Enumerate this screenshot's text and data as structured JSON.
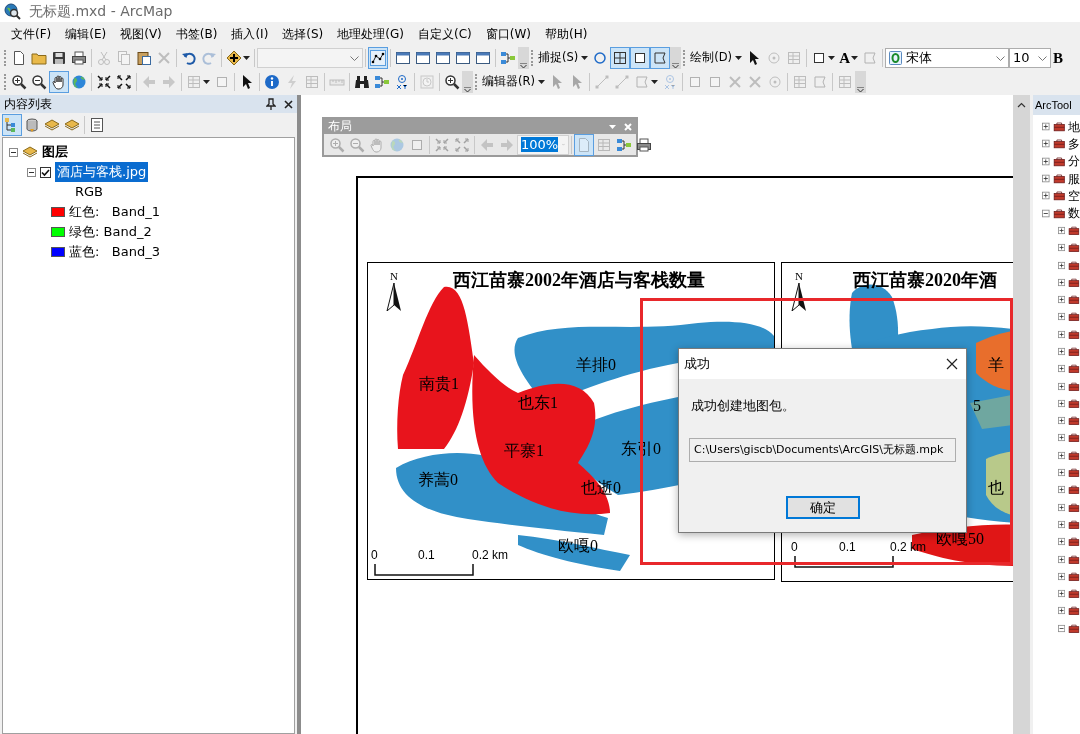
{
  "window": {
    "title": "无标题.mxd - ArcMap"
  },
  "menu": [
    "文件(F)",
    "编辑(E)",
    "视图(V)",
    "书签(B)",
    "插入(I)",
    "选择(S)",
    "地理处理(G)",
    "自定义(C)",
    "窗口(W)",
    "帮助(H)"
  ],
  "toolbar_1": [
    {
      "kind": "grip"
    },
    {
      "kind": "icon",
      "disabled": false,
      "pressed": false
    },
    {
      "kind": "icon",
      "disabled": false,
      "pressed": false
    },
    {
      "kind": "icon",
      "disabled": false,
      "pressed": false
    },
    {
      "kind": "icon",
      "disabled": false,
      "pressed": false
    },
    {
      "kind": "sep"
    },
    {
      "kind": "icon",
      "disabled": true,
      "pressed": false
    },
    {
      "kind": "icon",
      "disabled": true,
      "pressed": false
    },
    {
      "kind": "icon",
      "disabled": false,
      "pressed": false
    },
    {
      "kind": "icon",
      "disabled": true,
      "pressed": false
    },
    {
      "kind": "sep"
    },
    {
      "kind": "icon",
      "disabled": false,
      "pressed": false
    },
    {
      "kind": "icon",
      "disabled": true,
      "pressed": false
    },
    {
      "kind": "sep"
    },
    {
      "kind": "icon",
      "disabled": false,
      "pressed": false,
      "dropdown": true
    },
    {
      "kind": "sep"
    },
    {
      "kind": "combo",
      "disabled": true
    },
    {
      "kind": "sep"
    },
    {
      "kind": "icon",
      "disabled": false,
      "pressed": true
    },
    {
      "kind": "sep"
    },
    {
      "kind": "icon",
      "disabled": false,
      "pressed": false
    },
    {
      "kind": "icon",
      "disabled": false,
      "pressed": false
    },
    {
      "kind": "icon",
      "disabled": false,
      "pressed": false
    },
    {
      "kind": "icon",
      "disabled": false,
      "pressed": false
    },
    {
      "kind": "icon",
      "disabled": false,
      "pressed": false
    },
    {
      "kind": "sep"
    },
    {
      "kind": "icon",
      "disabled": false,
      "pressed": false
    },
    {
      "kind": "overflow"
    },
    {
      "kind": "grip"
    },
    {
      "kind": "menu",
      "label": "捕捉(S)"
    },
    {
      "kind": "icon",
      "disabled": false,
      "pressed": false
    },
    {
      "kind": "icon",
      "disabled": false,
      "pressed": true
    },
    {
      "kind": "icon",
      "disabled": false,
      "pressed": true
    },
    {
      "kind": "icon",
      "disabled": false,
      "pressed": true
    },
    {
      "kind": "overflow"
    },
    {
      "kind": "grip"
    },
    {
      "kind": "menu",
      "label": "绘制(D)"
    },
    {
      "kind": "icon",
      "disabled": false,
      "pressed": false
    },
    {
      "kind": "icon",
      "disabled": true,
      "pressed": false
    },
    {
      "kind": "icon",
      "disabled": true,
      "pressed": false
    },
    {
      "kind": "sep"
    },
    {
      "kind": "icon",
      "disabled": false,
      "pressed": false,
      "dropdown": true
    },
    {
      "kind": "letter",
      "label": "A",
      "dropdown": true
    },
    {
      "kind": "icon",
      "disabled": true,
      "pressed": false
    },
    {
      "kind": "sep"
    },
    {
      "kind": "font_combo",
      "value": "宋体"
    },
    {
      "kind": "combo",
      "value": "10",
      "disabled": false
    },
    {
      "kind": "letter",
      "label": "B"
    }
  ],
  "toolbar_2": [
    {
      "kind": "grip"
    },
    {
      "kind": "icon",
      "disabled": false,
      "pressed": false
    },
    {
      "kind": "icon",
      "disabled": false,
      "pressed": false
    },
    {
      "kind": "icon",
      "disabled": false,
      "pressed": true
    },
    {
      "kind": "icon",
      "disabled": false,
      "pressed": false
    },
    {
      "kind": "sep"
    },
    {
      "kind": "icon",
      "disabled": false,
      "pressed": false
    },
    {
      "kind": "icon",
      "disabled": false,
      "pressed": false
    },
    {
      "kind": "sep"
    },
    {
      "kind": "icon",
      "disabled": true,
      "pressed": false
    },
    {
      "kind": "icon",
      "disabled": true,
      "pressed": false
    },
    {
      "kind": "sep"
    },
    {
      "kind": "icon",
      "disabled": true,
      "pressed": false,
      "dropdown": true
    },
    {
      "kind": "icon",
      "disabled": true,
      "pressed": false
    },
    {
      "kind": "sep"
    },
    {
      "kind": "icon",
      "disabled": false,
      "pressed": false
    },
    {
      "kind": "sep"
    },
    {
      "kind": "icon",
      "disabled": false,
      "pressed": false
    },
    {
      "kind": "icon",
      "disabled": true,
      "pressed": false
    },
    {
      "kind": "icon",
      "disabled": true,
      "pressed": false
    },
    {
      "kind": "sep"
    },
    {
      "kind": "icon",
      "disabled": true,
      "pressed": false
    },
    {
      "kind": "sep"
    },
    {
      "kind": "icon",
      "disabled": false,
      "pressed": false
    },
    {
      "kind": "icon",
      "disabled": false,
      "pressed": false
    },
    {
      "kind": "icon",
      "disabled": false,
      "pressed": false
    },
    {
      "kind": "sep"
    },
    {
      "kind": "icon",
      "disabled": true,
      "pressed": false
    },
    {
      "kind": "sep"
    },
    {
      "kind": "icon",
      "disabled": false,
      "pressed": false
    },
    {
      "kind": "overflow"
    },
    {
      "kind": "grip"
    },
    {
      "kind": "menu",
      "label": "编辑器(R)"
    },
    {
      "kind": "icon",
      "disabled": true,
      "pressed": false
    },
    {
      "kind": "icon",
      "disabled": true,
      "pressed": false
    },
    {
      "kind": "sep"
    },
    {
      "kind": "icon",
      "disabled": true,
      "pressed": false
    },
    {
      "kind": "icon",
      "disabled": true,
      "pressed": false
    },
    {
      "kind": "icon",
      "disabled": true,
      "pressed": false,
      "dropdown": true
    },
    {
      "kind": "icon",
      "disabled": true,
      "pressed": false
    },
    {
      "kind": "sep"
    },
    {
      "kind": "icon",
      "disabled": true,
      "pressed": false
    },
    {
      "kind": "icon",
      "disabled": true,
      "pressed": false
    },
    {
      "kind": "icon",
      "disabled": true,
      "pressed": false
    },
    {
      "kind": "icon",
      "disabled": true,
      "pressed": false
    },
    {
      "kind": "icon",
      "disabled": true,
      "pressed": false
    },
    {
      "kind": "sep"
    },
    {
      "kind": "icon",
      "disabled": true,
      "pressed": false
    },
    {
      "kind": "icon",
      "disabled": true,
      "pressed": false
    },
    {
      "kind": "sep"
    },
    {
      "kind": "icon",
      "disabled": true,
      "pressed": false
    },
    {
      "kind": "overflow"
    }
  ],
  "toc": {
    "title": "内容列表",
    "toolbar": [
      {
        "kind": "icon",
        "pressed": true
      },
      {
        "kind": "icon",
        "pressed": false
      },
      {
        "kind": "icon",
        "pressed": false
      },
      {
        "kind": "icon",
        "pressed": false
      },
      {
        "kind": "sep"
      },
      {
        "kind": "icon",
        "pressed": false
      }
    ],
    "tree": [
      {
        "label": "图层",
        "expanded": true,
        "children": [
          {
            "label": "酒店与客栈.jpg",
            "expanded": true,
            "checked": true,
            "selected": true,
            "sublabel": "RGB",
            "legend": [
              {
                "text": "红色:   Band_1",
                "color": "#ff0000"
              },
              {
                "text": "绿色: Band_2",
                "color": "#00ff00"
              },
              {
                "text": "蓝色:   Band_3",
                "color": "#0000ff"
              }
            ]
          }
        ]
      }
    ]
  },
  "layout_toolbar": {
    "title": "布局",
    "items": [
      {
        "kind": "icon",
        "disabled": true,
        "pressed": false
      },
      {
        "kind": "icon",
        "disabled": true,
        "pressed": false
      },
      {
        "kind": "icon",
        "disabled": true,
        "pressed": false
      },
      {
        "kind": "icon",
        "disabled": true,
        "pressed": false
      },
      {
        "kind": "icon",
        "disabled": true,
        "pressed": false
      },
      {
        "kind": "sep"
      },
      {
        "kind": "icon",
        "disabled": true,
        "pressed": false
      },
      {
        "kind": "icon",
        "disabled": true,
        "pressed": false
      },
      {
        "kind": "sep"
      },
      {
        "kind": "icon",
        "disabled": true,
        "pressed": false
      },
      {
        "kind": "icon",
        "disabled": true,
        "pressed": false
      },
      {
        "kind": "combo",
        "value": "100%",
        "disabled": true,
        "highlighted": true
      },
      {
        "kind": "sep"
      },
      {
        "kind": "icon",
        "disabled": true,
        "pressed": true
      },
      {
        "kind": "icon",
        "disabled": true,
        "pressed": false
      },
      {
        "kind": "icon",
        "disabled": false,
        "pressed": false
      },
      {
        "kind": "icon",
        "disabled": false,
        "pressed": false
      }
    ]
  },
  "maps": [
    {
      "title": "西江苗寨2002年酒店与客栈数量",
      "north": "N",
      "labels": [
        "羊排0",
        "南贵1",
        "也东1",
        "平寨1",
        "东引0",
        "养蒿0",
        "也逝0",
        "欧嘎0"
      ],
      "scale_labels": [
        "0",
        "0.1",
        "0.2 km"
      ]
    },
    {
      "title": "西江苗寨2020年酒",
      "north": "N",
      "labels": [
        "羊",
        "5",
        "也",
        "欧嘎50"
      ],
      "scale_labels": [
        "0",
        "0.1",
        "0.2 km"
      ]
    }
  ],
  "highlight": {
    "color": "#e8282b"
  },
  "dialog": {
    "title": "成功",
    "message": "成功创建地图包。",
    "path": "C:\\Users\\giscb\\Documents\\ArcGIS\\无标题.mpk",
    "ok_button": "确定"
  },
  "arctoolbox": {
    "title": "ArcTool",
    "items": [
      {
        "label": "地",
        "expanded": false
      },
      {
        "label": "多",
        "expanded": false
      },
      {
        "label": "分",
        "expanded": false
      },
      {
        "label": "服",
        "expanded": false
      },
      {
        "label": "空",
        "expanded": false
      },
      {
        "label": "数",
        "expanded": true,
        "children": [
          {
            "expanded": false
          },
          {
            "expanded": false
          },
          {
            "expanded": false
          },
          {
            "expanded": false
          },
          {
            "expanded": false
          },
          {
            "expanded": false
          },
          {
            "expanded": false
          },
          {
            "expanded": false
          },
          {
            "expanded": false
          },
          {
            "expanded": false
          },
          {
            "expanded": false
          },
          {
            "expanded": false
          },
          {
            "expanded": false
          },
          {
            "expanded": false
          },
          {
            "expanded": false
          },
          {
            "expanded": false
          },
          {
            "expanded": false
          },
          {
            "expanded": false
          },
          {
            "expanded": false
          },
          {
            "expanded": false
          },
          {
            "expanded": false
          },
          {
            "expanded": false
          },
          {
            "expanded": false
          },
          {
            "expanded": true
          }
        ]
      }
    ]
  }
}
